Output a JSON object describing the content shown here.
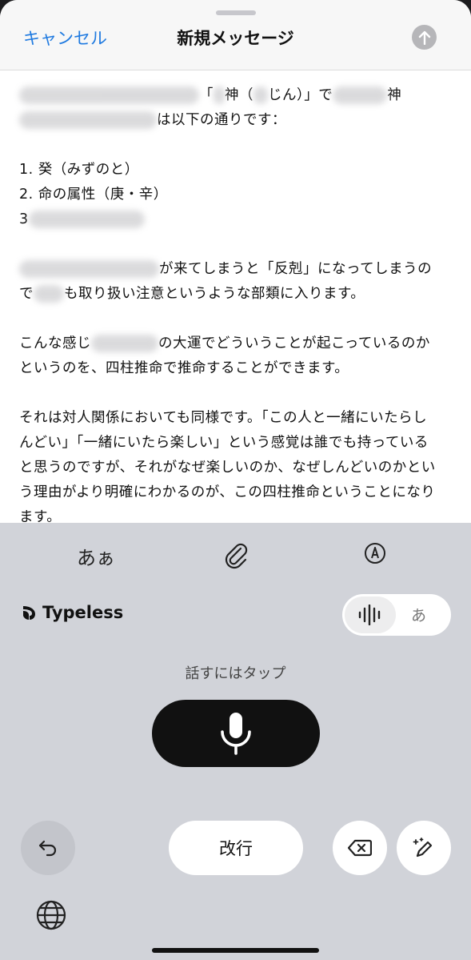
{
  "nav": {
    "cancel_label": "キャンセル",
    "title": "新規メッセージ"
  },
  "message": {
    "p1": {
      "l1_a": "「",
      "l1_b": "神（",
      "l1_c": "じん）」で",
      "l1_d": "神",
      "l2_a": "は以下の通りです："
    },
    "list": {
      "item1": "1. 癸（みずのと）",
      "item2": "2. 命の属性（庚・辛）",
      "item3": "3"
    },
    "p2": {
      "l1": "が来てしまうと「反剋」になってしまうの",
      "l2_a": "で",
      "l2_b": "も取り扱い注意というような部類に入ります。"
    },
    "p3": {
      "l1_a": "こんな感じ",
      "l1_b": "の大運でどういうことが起こっているのか",
      "l2": "というのを、四柱推命で推命することができます。"
    },
    "p4": {
      "l1": "それは対人関係においても同様です。「この人と一緒にいたらし",
      "l2": "んどい」「一緒にいたら楽しい」という感覚は誰でも持っている",
      "l3": "と思うのですが、それがなぜ楽しいのか、なぜしんどいのかとい",
      "l4": "う理由がより明確にわかるのが、この四柱推命ということになり",
      "l5": "ます。"
    }
  },
  "keyboard": {
    "toolbar": {
      "kana_label": "あぁ"
    },
    "brand_name": "Typeless",
    "mode_kana_label": "あ",
    "tap_hint": "話すにはタップ",
    "return_label": "改行"
  },
  "colors": {
    "accent": "#1f7ae0",
    "keyboard_bg": "#d1d3d9",
    "mic_button": "#111111"
  },
  "icons": [
    "arrow-up-icon",
    "paperclip-icon",
    "markup-pen-icon",
    "typeless-logo-icon",
    "waveform-icon",
    "microphone-icon",
    "undo-icon",
    "delete-icon",
    "magic-pen-icon",
    "globe-icon"
  ]
}
